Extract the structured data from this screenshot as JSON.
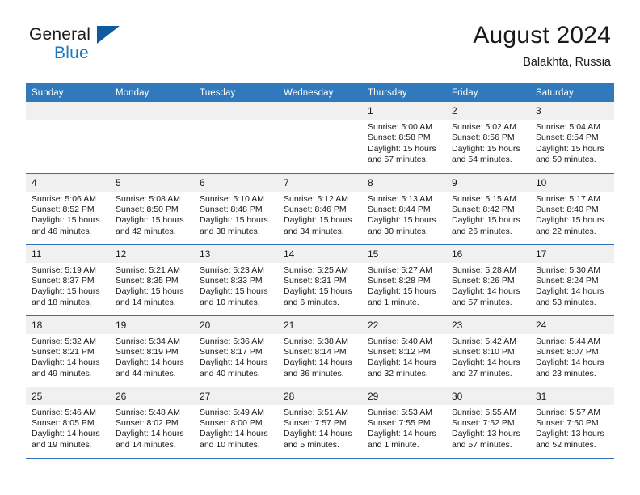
{
  "brand": {
    "line1": "General",
    "line2": "Blue",
    "triangle_color": "#0d5a9e",
    "blue_text_color": "#1b79c3"
  },
  "header": {
    "title": "August 2024",
    "subtitle": "Balakhta, Russia"
  },
  "theme": {
    "header_bg": "#3179bd",
    "row_divider": "#2e75b6",
    "daynum_bg": "#f0f0f0"
  },
  "weekday_headers": [
    "Sunday",
    "Monday",
    "Tuesday",
    "Wednesday",
    "Thursday",
    "Friday",
    "Saturday"
  ],
  "weeks": [
    [
      {
        "day": ""
      },
      {
        "day": ""
      },
      {
        "day": ""
      },
      {
        "day": ""
      },
      {
        "day": "1",
        "sunrise": "Sunrise: 5:00 AM",
        "sunset": "Sunset: 8:58 PM",
        "daylight": "Daylight: 15 hours and 57 minutes."
      },
      {
        "day": "2",
        "sunrise": "Sunrise: 5:02 AM",
        "sunset": "Sunset: 8:56 PM",
        "daylight": "Daylight: 15 hours and 54 minutes."
      },
      {
        "day": "3",
        "sunrise": "Sunrise: 5:04 AM",
        "sunset": "Sunset: 8:54 PM",
        "daylight": "Daylight: 15 hours and 50 minutes."
      }
    ],
    [
      {
        "day": "4",
        "sunrise": "Sunrise: 5:06 AM",
        "sunset": "Sunset: 8:52 PM",
        "daylight": "Daylight: 15 hours and 46 minutes."
      },
      {
        "day": "5",
        "sunrise": "Sunrise: 5:08 AM",
        "sunset": "Sunset: 8:50 PM",
        "daylight": "Daylight: 15 hours and 42 minutes."
      },
      {
        "day": "6",
        "sunrise": "Sunrise: 5:10 AM",
        "sunset": "Sunset: 8:48 PM",
        "daylight": "Daylight: 15 hours and 38 minutes."
      },
      {
        "day": "7",
        "sunrise": "Sunrise: 5:12 AM",
        "sunset": "Sunset: 8:46 PM",
        "daylight": "Daylight: 15 hours and 34 minutes."
      },
      {
        "day": "8",
        "sunrise": "Sunrise: 5:13 AM",
        "sunset": "Sunset: 8:44 PM",
        "daylight": "Daylight: 15 hours and 30 minutes."
      },
      {
        "day": "9",
        "sunrise": "Sunrise: 5:15 AM",
        "sunset": "Sunset: 8:42 PM",
        "daylight": "Daylight: 15 hours and 26 minutes."
      },
      {
        "day": "10",
        "sunrise": "Sunrise: 5:17 AM",
        "sunset": "Sunset: 8:40 PM",
        "daylight": "Daylight: 15 hours and 22 minutes."
      }
    ],
    [
      {
        "day": "11",
        "sunrise": "Sunrise: 5:19 AM",
        "sunset": "Sunset: 8:37 PM",
        "daylight": "Daylight: 15 hours and 18 minutes."
      },
      {
        "day": "12",
        "sunrise": "Sunrise: 5:21 AM",
        "sunset": "Sunset: 8:35 PM",
        "daylight": "Daylight: 15 hours and 14 minutes."
      },
      {
        "day": "13",
        "sunrise": "Sunrise: 5:23 AM",
        "sunset": "Sunset: 8:33 PM",
        "daylight": "Daylight: 15 hours and 10 minutes."
      },
      {
        "day": "14",
        "sunrise": "Sunrise: 5:25 AM",
        "sunset": "Sunset: 8:31 PM",
        "daylight": "Daylight: 15 hours and 6 minutes."
      },
      {
        "day": "15",
        "sunrise": "Sunrise: 5:27 AM",
        "sunset": "Sunset: 8:28 PM",
        "daylight": "Daylight: 15 hours and 1 minute."
      },
      {
        "day": "16",
        "sunrise": "Sunrise: 5:28 AM",
        "sunset": "Sunset: 8:26 PM",
        "daylight": "Daylight: 14 hours and 57 minutes."
      },
      {
        "day": "17",
        "sunrise": "Sunrise: 5:30 AM",
        "sunset": "Sunset: 8:24 PM",
        "daylight": "Daylight: 14 hours and 53 minutes."
      }
    ],
    [
      {
        "day": "18",
        "sunrise": "Sunrise: 5:32 AM",
        "sunset": "Sunset: 8:21 PM",
        "daylight": "Daylight: 14 hours and 49 minutes."
      },
      {
        "day": "19",
        "sunrise": "Sunrise: 5:34 AM",
        "sunset": "Sunset: 8:19 PM",
        "daylight": "Daylight: 14 hours and 44 minutes."
      },
      {
        "day": "20",
        "sunrise": "Sunrise: 5:36 AM",
        "sunset": "Sunset: 8:17 PM",
        "daylight": "Daylight: 14 hours and 40 minutes."
      },
      {
        "day": "21",
        "sunrise": "Sunrise: 5:38 AM",
        "sunset": "Sunset: 8:14 PM",
        "daylight": "Daylight: 14 hours and 36 minutes."
      },
      {
        "day": "22",
        "sunrise": "Sunrise: 5:40 AM",
        "sunset": "Sunset: 8:12 PM",
        "daylight": "Daylight: 14 hours and 32 minutes."
      },
      {
        "day": "23",
        "sunrise": "Sunrise: 5:42 AM",
        "sunset": "Sunset: 8:10 PM",
        "daylight": "Daylight: 14 hours and 27 minutes."
      },
      {
        "day": "24",
        "sunrise": "Sunrise: 5:44 AM",
        "sunset": "Sunset: 8:07 PM",
        "daylight": "Daylight: 14 hours and 23 minutes."
      }
    ],
    [
      {
        "day": "25",
        "sunrise": "Sunrise: 5:46 AM",
        "sunset": "Sunset: 8:05 PM",
        "daylight": "Daylight: 14 hours and 19 minutes."
      },
      {
        "day": "26",
        "sunrise": "Sunrise: 5:48 AM",
        "sunset": "Sunset: 8:02 PM",
        "daylight": "Daylight: 14 hours and 14 minutes."
      },
      {
        "day": "27",
        "sunrise": "Sunrise: 5:49 AM",
        "sunset": "Sunset: 8:00 PM",
        "daylight": "Daylight: 14 hours and 10 minutes."
      },
      {
        "day": "28",
        "sunrise": "Sunrise: 5:51 AM",
        "sunset": "Sunset: 7:57 PM",
        "daylight": "Daylight: 14 hours and 5 minutes."
      },
      {
        "day": "29",
        "sunrise": "Sunrise: 5:53 AM",
        "sunset": "Sunset: 7:55 PM",
        "daylight": "Daylight: 14 hours and 1 minute."
      },
      {
        "day": "30",
        "sunrise": "Sunrise: 5:55 AM",
        "sunset": "Sunset: 7:52 PM",
        "daylight": "Daylight: 13 hours and 57 minutes."
      },
      {
        "day": "31",
        "sunrise": "Sunrise: 5:57 AM",
        "sunset": "Sunset: 7:50 PM",
        "daylight": "Daylight: 13 hours and 52 minutes."
      }
    ]
  ]
}
